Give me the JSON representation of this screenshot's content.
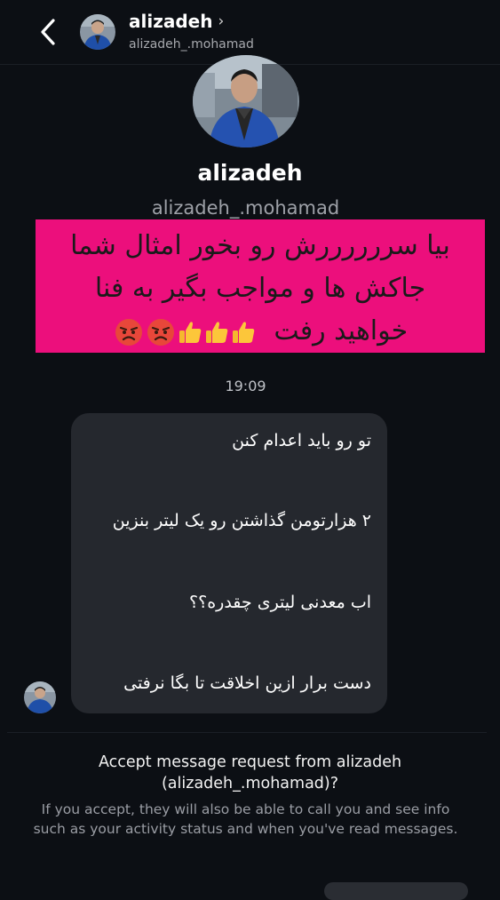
{
  "header": {
    "name": "alizadeh",
    "handle": "alizadeh_.mohamad"
  },
  "profile": {
    "name": "alizadeh",
    "handle": "alizadeh_.mohamad"
  },
  "pinned_message": {
    "line1": "بیا سررررررش رو بخور امثال شما",
    "line2": "جاکش ها و مواجب بگیر به فنا",
    "line3": "خواهید رفت",
    "emojis": [
      "thumbs-up-icon",
      "thumbs-up-icon",
      "thumbs-up-icon",
      "angry-face-icon",
      "angry-face-icon"
    ]
  },
  "timestamp": "19:09",
  "bubble_messages": [
    "تو رو باید اعدام کنن",
    "۲ هزارتومن گذاشتن رو یک لیتر بنزین",
    "اب معدنی لیتری چقدره؟؟",
    "دست برار ازین اخلاقت تا بگا نرفتی"
  ],
  "request": {
    "title_line1": "Accept message request from alizadeh",
    "title_line2": "(alizadeh_.mohamad)?",
    "description": "If you accept, they will also be able to call you and see info such as your activity status and when you've read messages."
  },
  "colors": {
    "background": "#0c0f14",
    "pink_block": "#ec0f7c",
    "bubble": "#25282e"
  }
}
